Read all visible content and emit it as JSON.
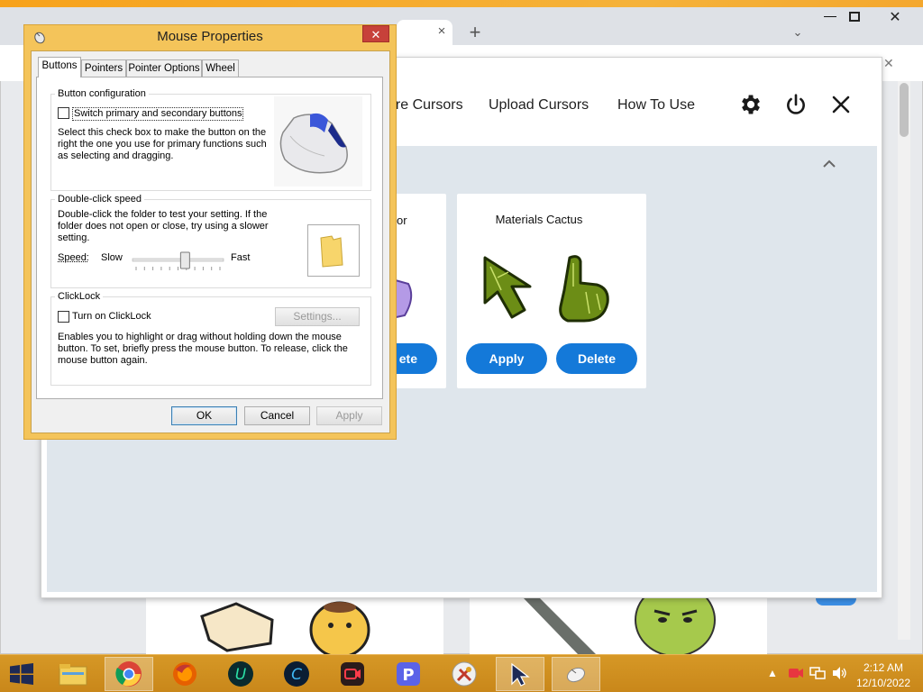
{
  "browser": {
    "tab_close": "×",
    "new_tab": "+",
    "tab_dropdown": "⌄",
    "minimize": "—",
    "close": "✕"
  },
  "extension": {
    "nav": {
      "more_cursors": "ore Cursors",
      "upload_cursors": "Upload Cursors",
      "how_to_use": "How To Use"
    },
    "header_icons": [
      "gear-icon",
      "power-icon",
      "close-icon"
    ],
    "close_symbol": "✕",
    "card_left": {
      "title": "or",
      "delete_label": "ete"
    },
    "card_cactus": {
      "title": "Materials Cactus",
      "apply_label": "Apply",
      "delete_label": "Delete"
    },
    "accent_color": "#1479d9"
  },
  "dialog": {
    "title": "Mouse Properties",
    "close_symbol": "✕",
    "tabs": [
      "Buttons",
      "Pointers",
      "Pointer Options",
      "Wheel"
    ],
    "active_tab": "Buttons",
    "button_config": {
      "group_title": "Button configuration",
      "checkbox_label": "Switch primary and secondary buttons",
      "checked": false,
      "description": "Select this check box to make the button on the right the one you use for primary functions such as selecting and dragging."
    },
    "double_click": {
      "group_title": "Double-click speed",
      "description": "Double-click the folder to test your setting. If the folder does not open or close, try using a slower setting.",
      "speed_label": "Speed:",
      "slow_label": "Slow",
      "fast_label": "Fast",
      "slider_value": 0.58
    },
    "clicklock": {
      "group_title": "ClickLock",
      "checkbox_label": "Turn on ClickLock",
      "checked": false,
      "settings_label": "Settings...",
      "description": "Enables you to highlight or drag without holding down the mouse button. To set, briefly press the mouse button. To release, click the mouse button again."
    },
    "buttons": {
      "ok": "OK",
      "cancel": "Cancel",
      "apply": "Apply"
    }
  },
  "taskbar": {
    "items": [
      "start-icon",
      "file-explorer-icon",
      "chrome-icon",
      "firefox-icon",
      "u-app-icon",
      "c-app-icon",
      "screen-recorder-icon",
      "p-app-icon",
      "tools-app-icon",
      "cursor-app-icon",
      "mouse-properties-icon"
    ],
    "time": "2:12 AM",
    "date": "12/10/2022"
  }
}
